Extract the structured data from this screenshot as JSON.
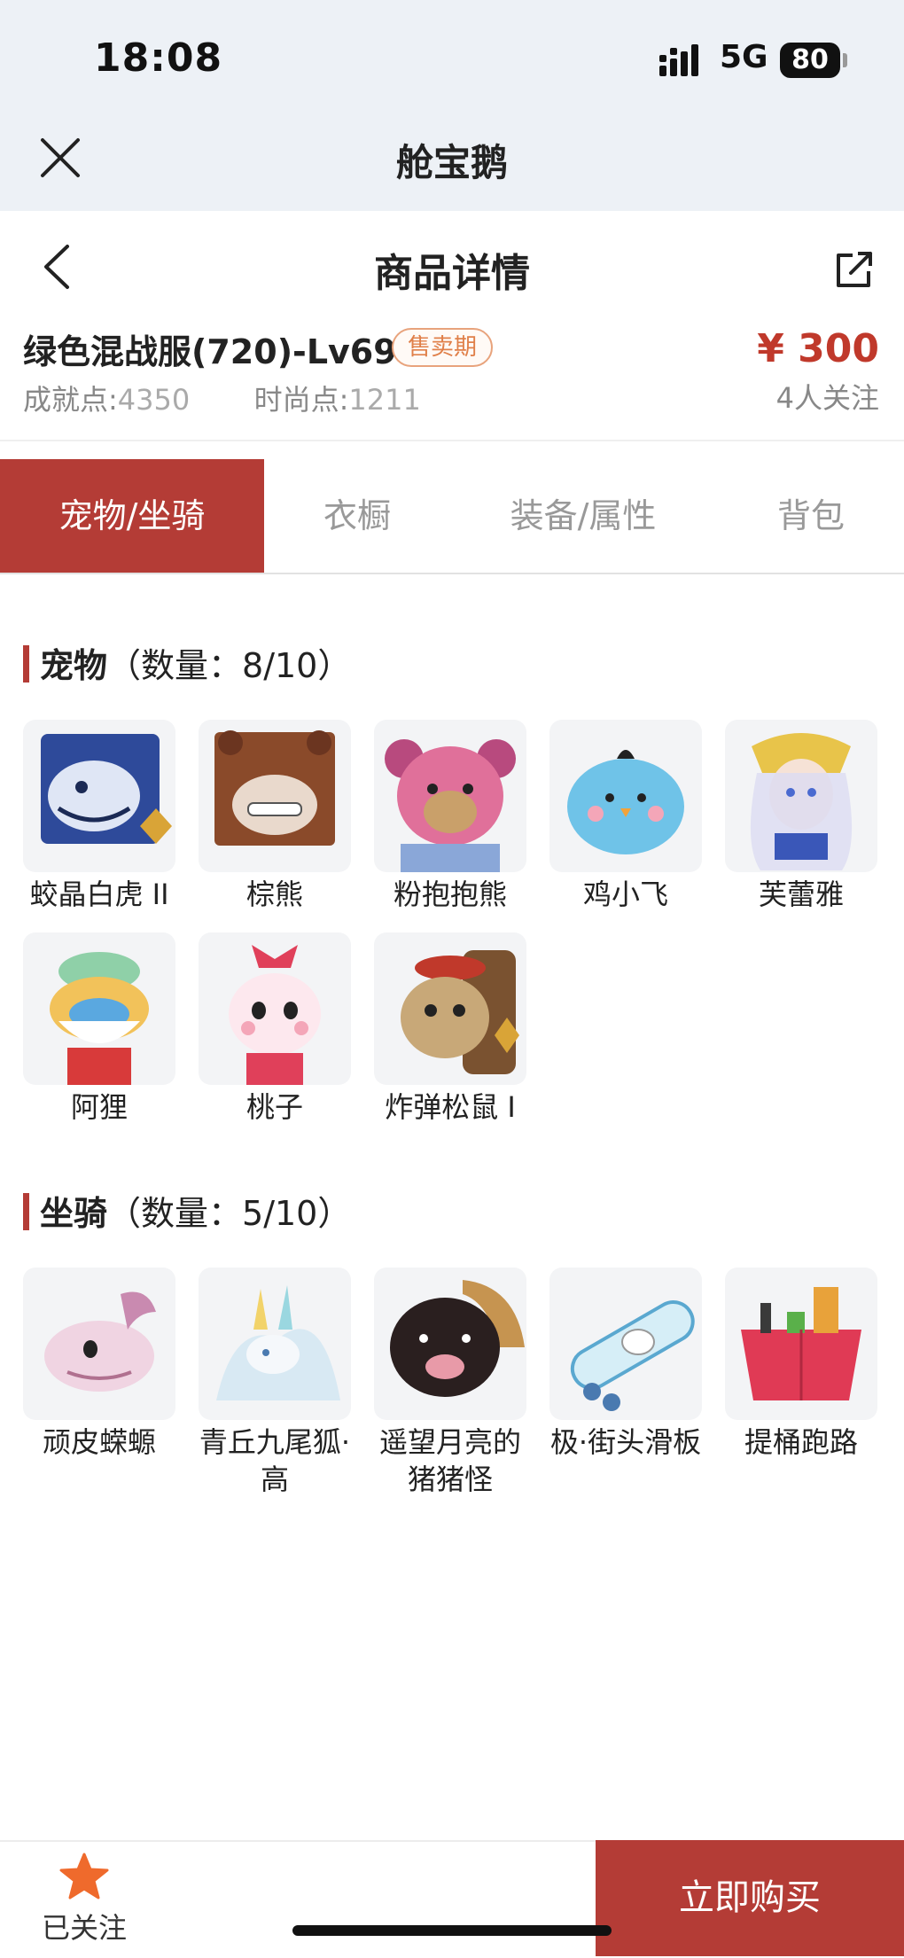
{
  "status_bar": {
    "time": "18:08",
    "network": "5G",
    "battery": "80"
  },
  "app_bar": {
    "title": "舱宝鹅",
    "close_icon": "close-icon"
  },
  "header": {
    "title": "商品详情",
    "back_icon": "chevron-left-icon",
    "share_icon": "share-icon"
  },
  "product": {
    "name": "绿色混战服(720)-Lv69",
    "badge": "售卖期",
    "price": "¥ 300",
    "achievement_label": "成就点:",
    "achievement_value": "4350",
    "fashion_label": "时尚点:",
    "fashion_value": "1211",
    "followers": "4人关注"
  },
  "tabs": [
    {
      "label": "宠物/坐骑",
      "active": true
    },
    {
      "label": "衣橱",
      "active": false
    },
    {
      "label": "装备/属性",
      "active": false
    },
    {
      "label": "背包",
      "active": false
    }
  ],
  "pets": {
    "title": "宠物",
    "count_text": "（数量：8/10）",
    "items": [
      {
        "name": "蛟晶白虎 II",
        "color": "#3b5fb0"
      },
      {
        "name": "棕熊",
        "color": "#8a4a2a"
      },
      {
        "name": "粉抱抱熊",
        "color": "#e0709a"
      },
      {
        "name": "鸡小飞",
        "color": "#6fc3e8"
      },
      {
        "name": "芙蕾雅",
        "color": "#c9c4e6"
      },
      {
        "name": "阿狸",
        "color": "#e9a040"
      },
      {
        "name": "桃子",
        "color": "#f2a7c0"
      },
      {
        "name": "炸弹松鼠 I",
        "color": "#b08a5a"
      }
    ]
  },
  "mounts": {
    "title": "坐骑",
    "count_text": "（数量：5/10）",
    "items": [
      {
        "name": "顽皮蝾螈",
        "color": "#e9b8cf"
      },
      {
        "name": "青丘九尾狐·高",
        "color": "#cfe3f0"
      },
      {
        "name": "遥望月亮的猪猪怪",
        "color": "#3a2a2a"
      },
      {
        "name": "极·街头滑板",
        "color": "#9fd0e6"
      },
      {
        "name": "提桶跑路",
        "color": "#e03a55"
      }
    ]
  },
  "bottom_bar": {
    "follow_label": "已关注",
    "buy_label": "立即购买"
  },
  "colors": {
    "accent": "#b43c36",
    "price": "#c0392b",
    "badge": "#e0804a"
  }
}
